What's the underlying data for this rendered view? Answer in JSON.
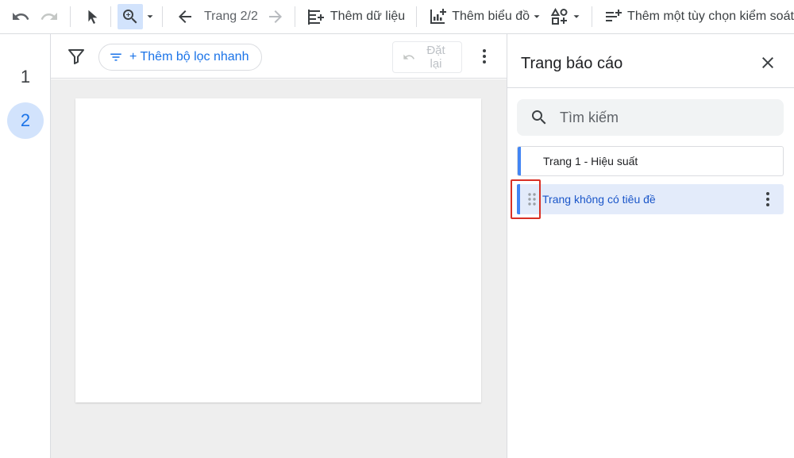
{
  "toolbar": {
    "page_indicator": "Trang 2/2",
    "add_data_label": "Thêm dữ liệu",
    "add_chart_label": "Thêm biểu đồ",
    "add_control_label": "Thêm một tùy chọn kiểm soát"
  },
  "rail": {
    "pages": [
      {
        "number": "1",
        "active": false
      },
      {
        "number": "2",
        "active": true
      }
    ]
  },
  "filterbar": {
    "quick_filter_label": "+ Thêm bộ lọc nhanh",
    "reset_label": "Đặt lại"
  },
  "panel": {
    "title": "Trang báo cáo",
    "search_placeholder": "Tìm kiếm",
    "pages": [
      {
        "label": "Trang 1 - Hiệu suất",
        "selected": false
      },
      {
        "label": "Trang không có tiêu đề",
        "selected": true
      }
    ]
  },
  "colors": {
    "accent": "#1a73e8",
    "selected_bg": "#e3ebfa",
    "highlight": "#d93025"
  }
}
